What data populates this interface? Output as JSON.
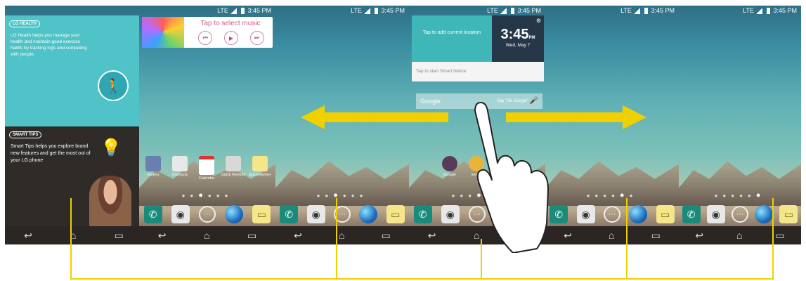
{
  "status": {
    "network": "LTE",
    "time": "3:45 PM"
  },
  "health_panel": {
    "badge": "LG HEALTH",
    "text": "LG Health helps you manage your health and maintain good exercise habits by tracking logs and competing with people."
  },
  "tips_panel": {
    "badge": "SMART TIPS",
    "text": "Smart Tips helps you explore brand new features and get the most out of your LG phone"
  },
  "music_widget": {
    "label": "Tap to select music",
    "prev": "⏮",
    "play": "▶",
    "next": "⏭"
  },
  "clock_widget": {
    "location": "Tap to add current location",
    "time": "3:45",
    "ampm": "PM",
    "date": "Wed, May 7",
    "gear": "⚙"
  },
  "smart_notice": {
    "text": "Tap to start Smart Notice"
  },
  "google_search": {
    "brand": "Google",
    "hint": "Say \"Ok Google\"",
    "mic": "🎤"
  },
  "home_apps": [
    {
      "label": "Gallery"
    },
    {
      "label": "Contacts"
    },
    {
      "label": "Calendar"
    },
    {
      "label": "Quick Remote"
    },
    {
      "label": "QuickMemo+"
    }
  ],
  "center_apps": [
    {
      "label": "Google"
    },
    {
      "label": "Email"
    }
  ],
  "dock_icons": {
    "phone": "✆",
    "camera": "◉",
    "apps": "⋯",
    "browser": "",
    "messaging": "▭"
  },
  "nav_icons": {
    "back": "↩",
    "home": "⌂",
    "recent": "▭"
  },
  "colors": {
    "accent_yellow": "#f0d000",
    "teal": "#3fb6b8",
    "dark": "#2b2624"
  }
}
